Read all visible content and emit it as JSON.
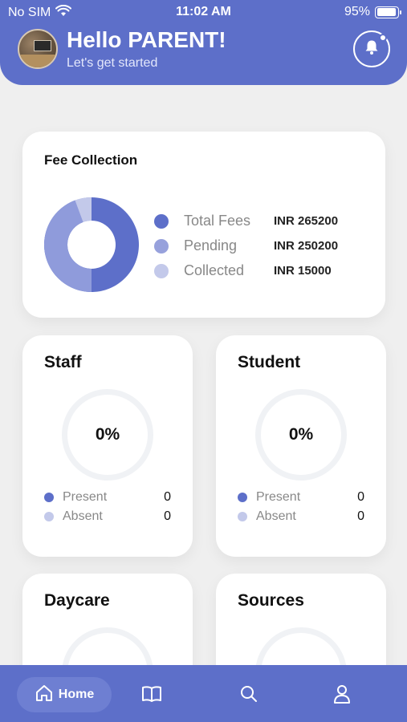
{
  "status_bar": {
    "carrier": "No SIM",
    "time": "11:02 AM",
    "battery_percent_text": "95%",
    "battery_level": 0.95
  },
  "header": {
    "greeting": "Hello PARENT!",
    "subtitle": "Let's get started",
    "bell_icon": "bell-icon",
    "bg_color": "#5d6fc9"
  },
  "fee_collection": {
    "title": "Fee Collection",
    "chart_data": {
      "type": "pie",
      "slices": [
        {
          "label": "Pending",
          "value": 250200,
          "color": "#5d6fc9"
        },
        {
          "label": "Collected",
          "value": 15000,
          "color": "#c3c9ea"
        }
      ],
      "accent_colors": [
        "#5d6fc9",
        "#8f9bdb",
        "#c3c9ea"
      ]
    },
    "legend": [
      {
        "label": "Total Fees",
        "value": "INR 265200",
        "color": "#5d6fc9"
      },
      {
        "label": "Pending",
        "value": "INR 250200",
        "color": "#97a1dc"
      },
      {
        "label": "Collected",
        "value": "INR 15000",
        "color": "#c3c9ea"
      }
    ]
  },
  "staff": {
    "title": "Staff",
    "percent": "0%",
    "present_label": "Present",
    "present_value": "0",
    "absent_label": "Absent",
    "absent_value": "0"
  },
  "student": {
    "title": "Student",
    "percent": "0%",
    "present_label": "Present",
    "present_value": "0",
    "absent_label": "Absent",
    "absent_value": "0"
  },
  "daycare": {
    "title": "Daycare"
  },
  "sources": {
    "title": "Sources"
  },
  "bottom_nav": {
    "home_label": "Home",
    "icons": [
      "home-icon",
      "book-icon",
      "search-icon",
      "profile-icon"
    ]
  }
}
